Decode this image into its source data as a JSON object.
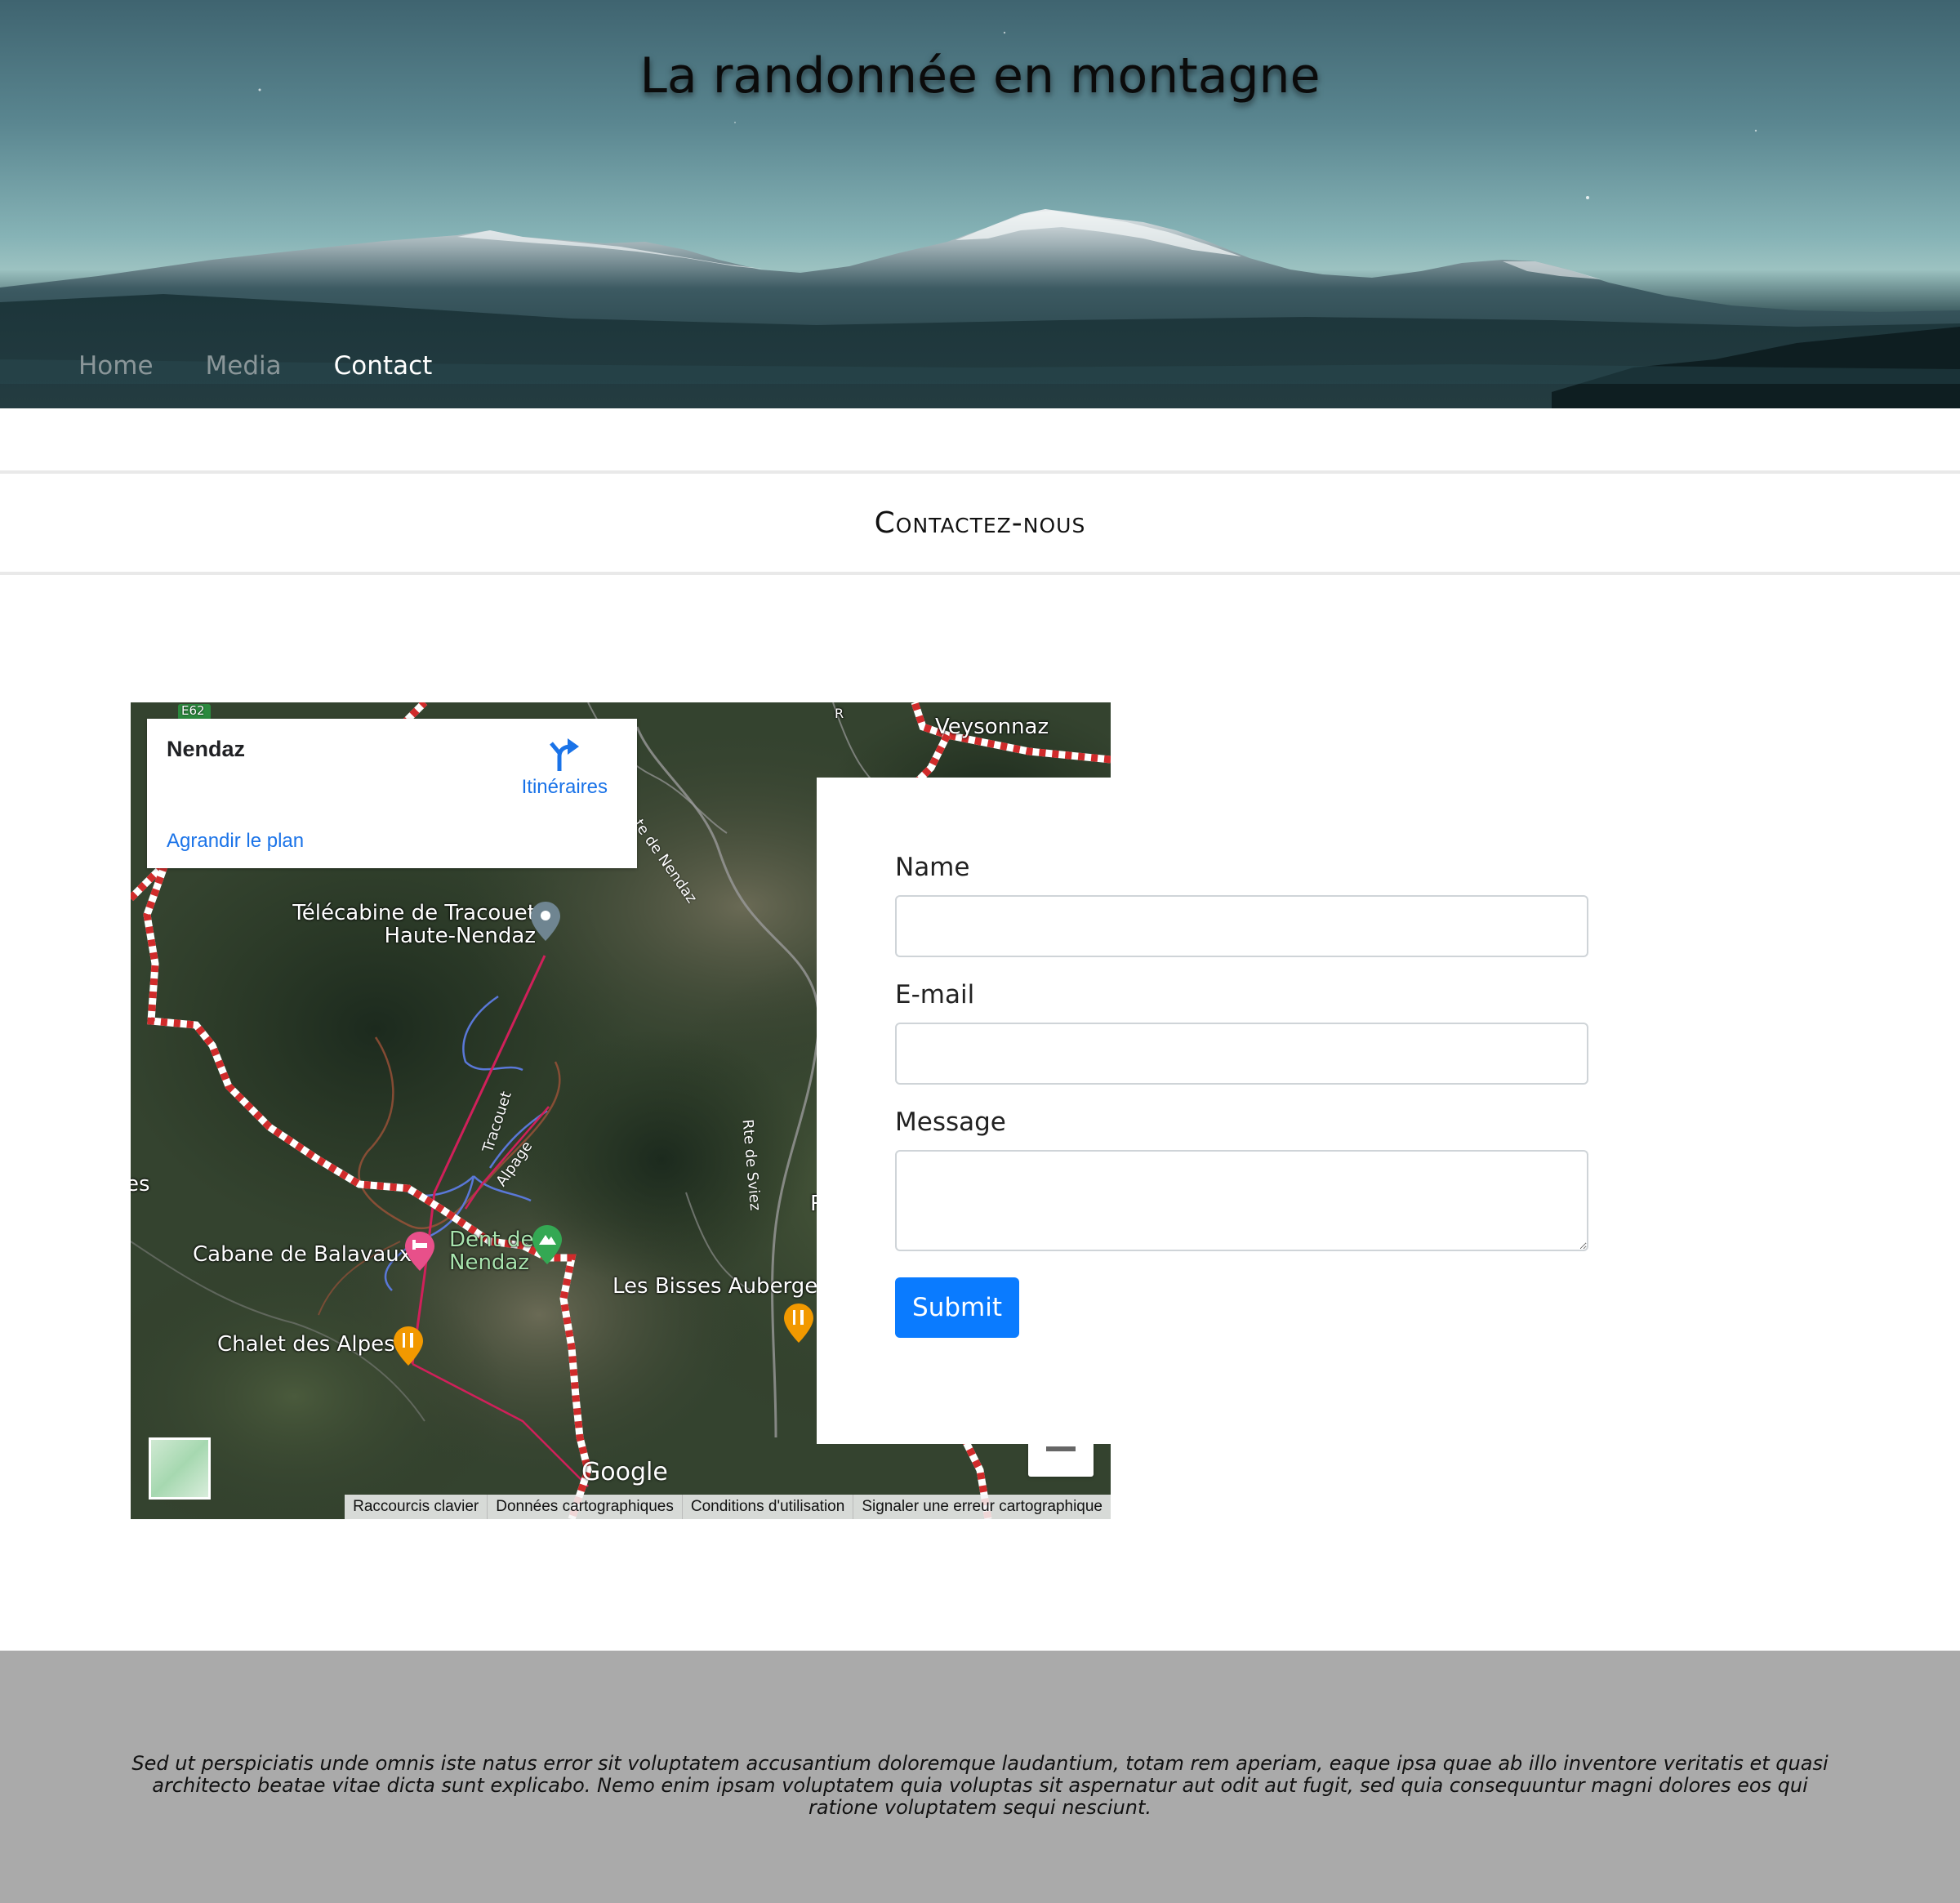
{
  "site": {
    "title": "La randonnée en montagne"
  },
  "nav": {
    "items": [
      {
        "label": "Home",
        "active": false
      },
      {
        "label": "Media",
        "active": false
      },
      {
        "label": "Contact",
        "active": true
      }
    ]
  },
  "section": {
    "heading": "Contactez-nous"
  },
  "map": {
    "info_card": {
      "title": "Nendaz",
      "directions_label": "Itinéraires",
      "enlarge_link": "Agrandir le plan"
    },
    "places": {
      "veysonnaz": "Veysonnaz",
      "telecabine_line1": "Télécabine de Tracouet",
      "telecabine_line2": "Haute-Nendaz",
      "cabane": "Cabane de Balavaux",
      "dent_line1": "Dent de",
      "dent_line2": "Nendaz",
      "bisses": "Les Bisses Auberge",
      "chalet": "Chalet des Alpes",
      "edge_es": "es",
      "edge_r": "R",
      "edge_r2": "R"
    },
    "roads": {
      "e62": "E62",
      "nendaz_road": "te de Nendaz",
      "tracouet": "Tracouet",
      "alpage": "Alpage",
      "sviez": "Rte de Sviez"
    },
    "logo": "Google",
    "attribution": [
      "Raccourcis clavier",
      "Données cartographiques",
      "Conditions d'utilisation",
      "Signaler une erreur cartographique"
    ],
    "colors": {
      "pin_gray": "#6f8591",
      "pin_pink": "#e8508a",
      "pin_green": "#34a853",
      "pin_orange": "#f29900",
      "link_blue": "#1a73e8"
    }
  },
  "form": {
    "name_label": "Name",
    "email_label": "E-mail",
    "message_label": "Message",
    "name_value": "",
    "email_value": "",
    "message_value": "",
    "submit_label": "Submit"
  },
  "footer": {
    "text": "Sed ut perspiciatis unde omnis iste natus error sit voluptatem accusantium doloremque laudantium, totam rem aperiam, eaque ipsa quae ab illo inventore veritatis et quasi architecto beatae vitae dicta sunt explicabo. Nemo enim ipsam voluptatem quia voluptas sit aspernatur aut odit aut fugit, sed quia consequuntur magni dolores eos qui ratione voluptatem sequi nesciunt."
  },
  "theme": {
    "accent": "#0a7bff",
    "footer_bg": "#aaaaaa"
  }
}
